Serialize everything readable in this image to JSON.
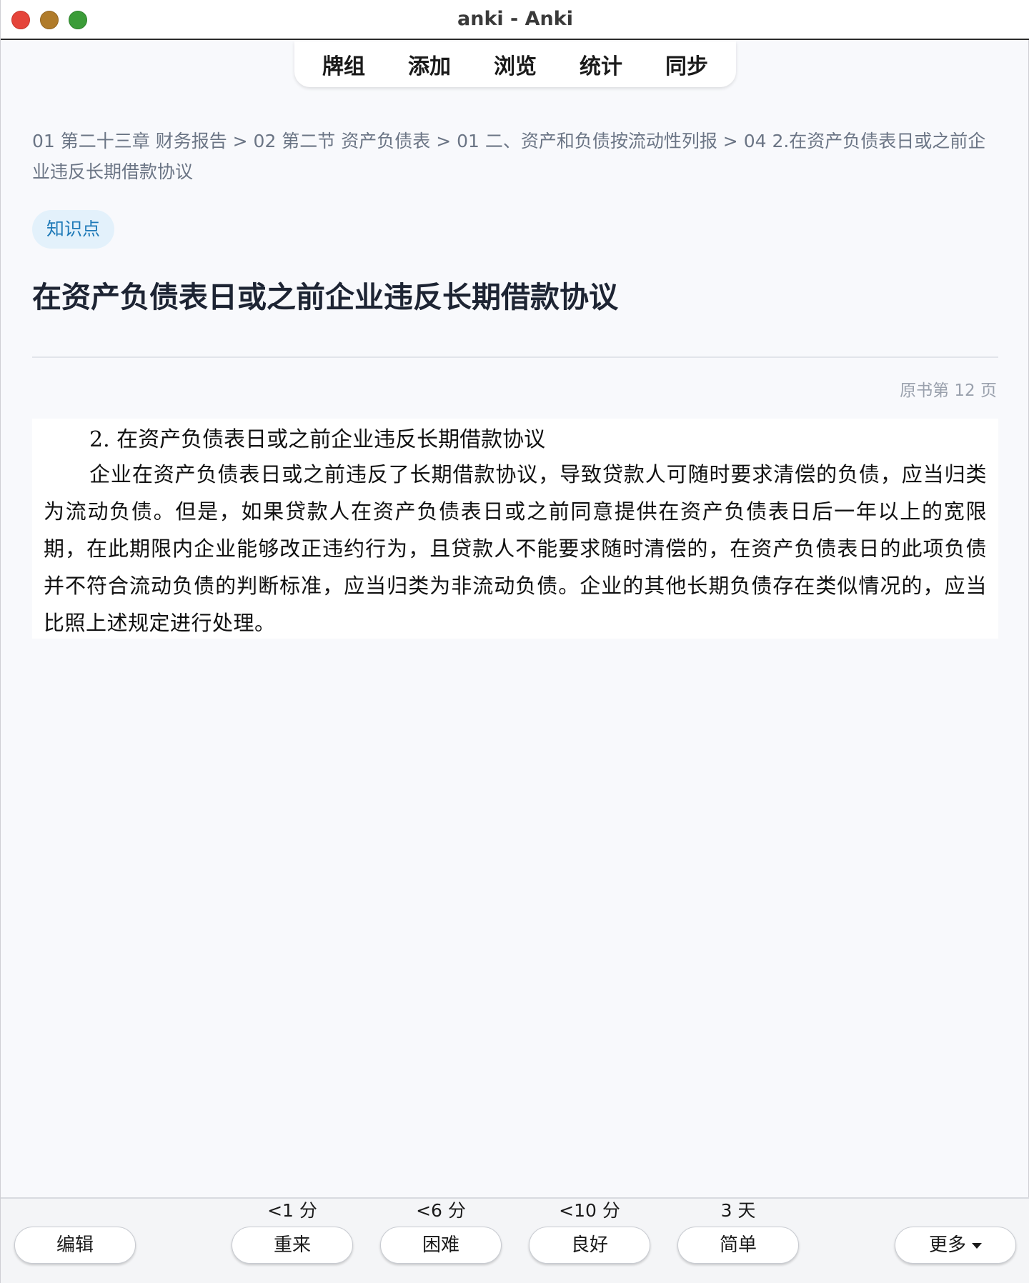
{
  "window": {
    "title": "anki - Anki"
  },
  "nav": {
    "items": [
      "牌组",
      "添加",
      "浏览",
      "统计",
      "同步"
    ]
  },
  "card": {
    "breadcrumb": "01 第二十三章 财务报告 > 02 第二节 资产负债表 > 01 二、资产和负债按流动性列报 > 04 2.在资产负债表日或之前企业违反长期借款协议",
    "tag": "知识点",
    "title": "在资产负债表日或之前企业违反长期借款协议",
    "page_ref": "原书第 12 页",
    "excerpt_heading": "2. 在资产负债表日或之前企业违反长期借款协议",
    "excerpt_body": "企业在资产负债表日或之前违反了长期借款协议，导致贷款人可随时要求清偿的负债，应当归类为流动负债。但是，如果贷款人在资产负债表日或之前同意提供在资产负债表日后一年以上的宽限期，在此期限内企业能够改正违约行为，且贷款人不能要求随时清偿的，在资产负债表日的此项负债并不符合流动负债的判断标准，应当归类为非流动负债。企业的其他长期负债存在类似情况的，应当比照上述规定进行处理。"
  },
  "bottom": {
    "edit_label": "编辑",
    "more_label": "更多",
    "answers": [
      {
        "interval": "<1 分",
        "label": "重来"
      },
      {
        "interval": "<6 分",
        "label": "困难"
      },
      {
        "interval": "<10 分",
        "label": "良好"
      },
      {
        "interval": "3 天",
        "label": "简单"
      }
    ]
  }
}
